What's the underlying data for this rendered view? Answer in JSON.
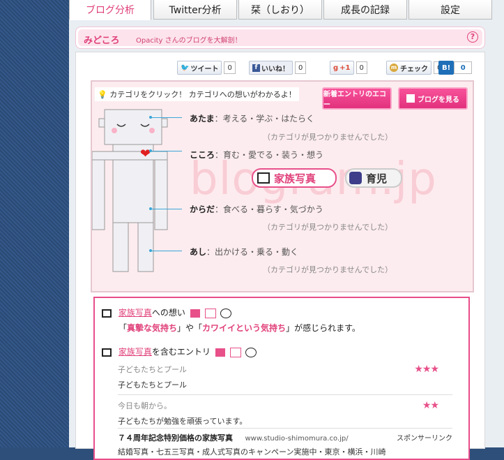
{
  "tabs": [
    {
      "label": "ブログ分析",
      "active": true
    },
    {
      "label": "Twitter分析",
      "active": false
    },
    {
      "label": "栞（しおり）",
      "active": false
    },
    {
      "label": "成長の記録",
      "active": false
    },
    {
      "label": "設定",
      "active": false
    }
  ],
  "midokoro": {
    "title": "みどころ",
    "desc": "Opacity さんのブログを大解剖！",
    "help": "?"
  },
  "social": {
    "tweet": "ツイート",
    "tweet_count": "0",
    "like": "いいね！",
    "like_count": "0",
    "gplus": "+1",
    "gplus_count": "0",
    "check": "チェック",
    "check_count": "0",
    "hatena": "B!",
    "hatena_count": "0"
  },
  "stage": {
    "hint": "カテゴリをクリック！ カテゴリへの想いがわかるよ！",
    "echo_button": "新着エントリのエコー",
    "view_blog_button": "ブログを見る",
    "watermark": "blogram.jp",
    "categories": [
      {
        "head": "あたま",
        "items": "：考える・学ぶ・はたらく",
        "note": "（カテゴリが見つかりませんでした）"
      },
      {
        "head": "こころ",
        "items": "：育む・愛でる・装う・想う",
        "note": ""
      },
      {
        "head": "からだ",
        "items": "：食べる・暮らす・気づかう",
        "note": "（カテゴリが見つかりませんでした）"
      },
      {
        "head": "あし",
        "items": "：出かける・乗る・動く",
        "note": "（カテゴリが見つかりませんでした）"
      }
    ],
    "tags": [
      {
        "label": "家族写真"
      },
      {
        "label": "育児"
      }
    ]
  },
  "info": {
    "feel_title_link": "家族写真",
    "feel_title_suffix": "への想い",
    "feel_prefix": "「",
    "feel_word1": "真摯な気持ち",
    "feel_mid": "」や「",
    "feel_word2": "カワイイという気持ち",
    "feel_suffix": "」が感じられます。",
    "entries_title_link": "家族写真",
    "entries_title_suffix": "を含むエントリ",
    "entries": [
      {
        "title": "子どもたちとプール",
        "desc": "子どもたちとプール",
        "stars": "★★★"
      },
      {
        "title": "今日も朝から。",
        "desc": "子どもたちが勉強を頑張っています。",
        "stars": "★★"
      }
    ],
    "sponsor": {
      "title": "７４周年記念特別価格の家族写真",
      "url": "www.studio-shimomura.co.jp/",
      "label": "スポンサーリンク",
      "desc": "結婚写真・七五三写真・成人式写真のキャンペーン実施中・東京・横浜・川崎"
    }
  },
  "colors": {
    "accent": "#e0407a",
    "bg": "#2d4f7a"
  }
}
